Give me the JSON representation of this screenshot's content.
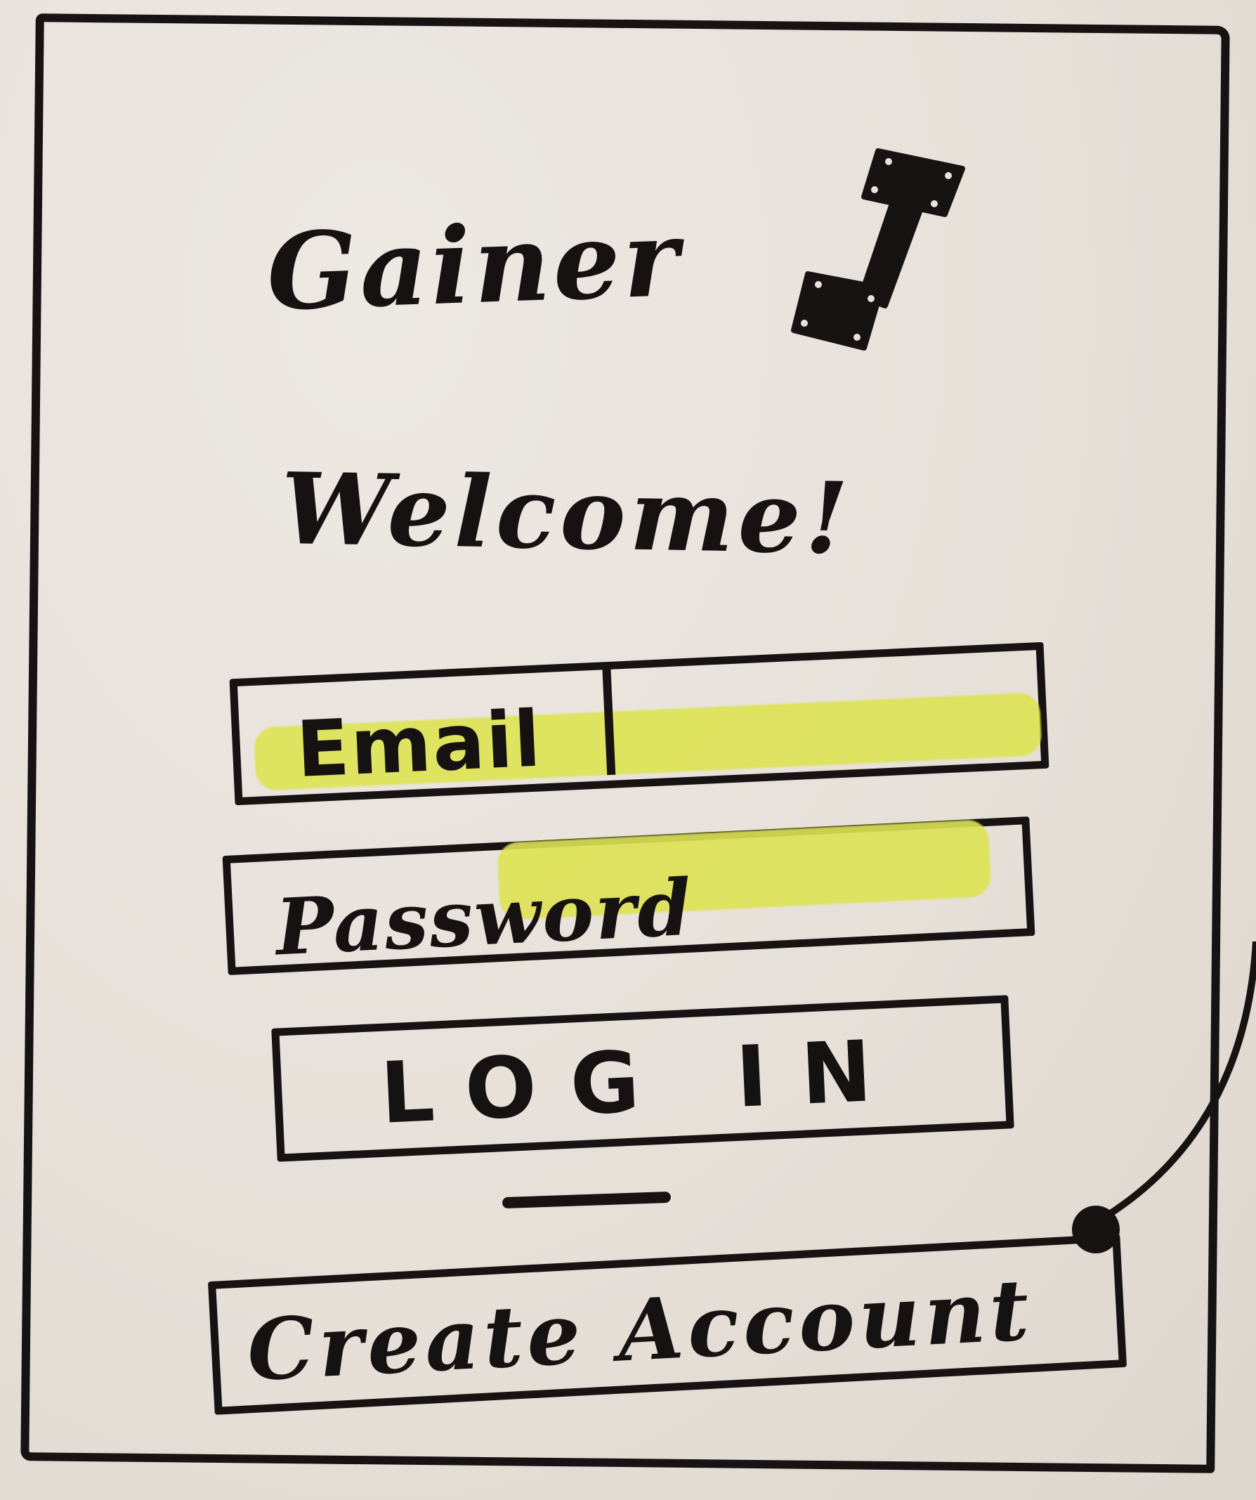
{
  "app": {
    "name": "Gainer",
    "logo_icon": "dumbbell-icon"
  },
  "welcome": {
    "text": "Welcome!"
  },
  "form": {
    "email_label": "Email",
    "password_label": "Password"
  },
  "buttons": {
    "login_label": "LOG IN",
    "create_account_label": "Create Account"
  },
  "colors": {
    "ink": "#171313",
    "paper": "#e7e2db",
    "highlight": "#dde353"
  }
}
